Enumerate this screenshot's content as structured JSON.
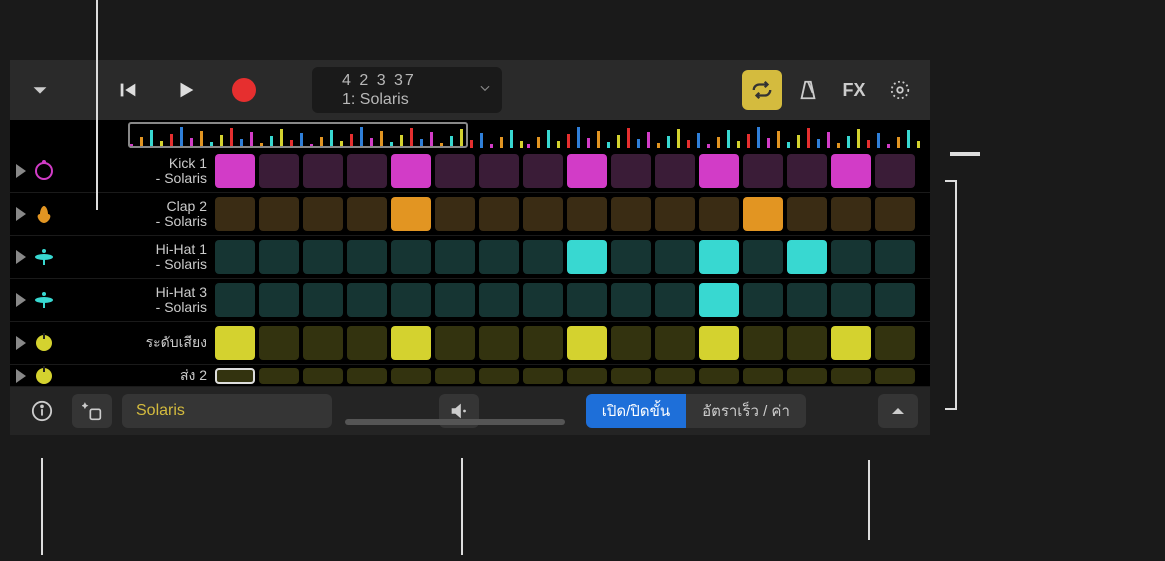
{
  "toolbar": {
    "display_top": "4  2  3   37",
    "display_bottom": "1: Solaris",
    "fx_label": "FX"
  },
  "tracks": [
    {
      "label": "Kick 1\n- Solaris",
      "icon": "circle-icon",
      "color": "#d23cc7",
      "dim": "#3a1c37",
      "steps": [
        1,
        0,
        0,
        0,
        1,
        0,
        0,
        0,
        1,
        0,
        0,
        1,
        0,
        0,
        1,
        0
      ]
    },
    {
      "label": "Clap 2\n- Solaris",
      "icon": "hand-icon",
      "color": "#e29522",
      "dim": "#3a2c14",
      "steps": [
        0,
        0,
        0,
        0,
        1,
        0,
        0,
        0,
        0,
        0,
        0,
        0,
        1,
        0,
        0,
        0
      ]
    },
    {
      "label": "Hi-Hat 1\n- Solaris",
      "icon": "hihat-icon",
      "color": "#38d8d1",
      "dim": "#163533",
      "steps": [
        0,
        0,
        0,
        0,
        0,
        0,
        0,
        0,
        1,
        0,
        0,
        1,
        0,
        1,
        0,
        0
      ]
    },
    {
      "label": "Hi-Hat 3\n- Solaris",
      "icon": "hihat-icon",
      "color": "#38d8d1",
      "dim": "#163533",
      "steps": [
        0,
        0,
        0,
        0,
        0,
        0,
        0,
        0,
        0,
        0,
        0,
        1,
        0,
        0,
        0,
        0
      ]
    },
    {
      "label": "ระดับเสียง",
      "icon": "knob-icon",
      "color": "#d4d22f",
      "dim": "#33330f",
      "steps": [
        1,
        0,
        0,
        0,
        1,
        0,
        0,
        0,
        1,
        0,
        0,
        1,
        0,
        0,
        1,
        0
      ]
    },
    {
      "label": "ส่ง 2",
      "icon": "knob-icon",
      "color": "#d4d22f",
      "dim": "#33330f",
      "partial": true,
      "steps": [
        0,
        0,
        0,
        0,
        0,
        0,
        0,
        0,
        0,
        0,
        0,
        0,
        0,
        0,
        0,
        0
      ],
      "selected_step": 0
    }
  ],
  "bottom": {
    "name": "Solaris",
    "seg_on": "เปิด/ปิดขั้น",
    "seg_rate": "อัตราเร็ว / ค่า"
  },
  "overview_colors": [
    "#d23cc7",
    "#e29522",
    "#38d8d1",
    "#d4d22f",
    "#e62f2f",
    "#2f7fd9"
  ]
}
